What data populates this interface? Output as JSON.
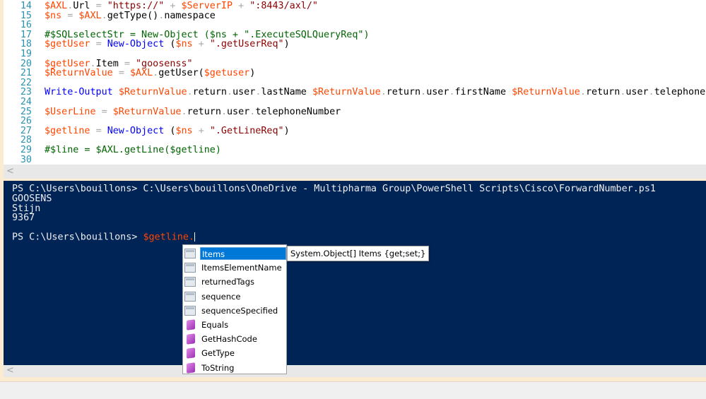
{
  "editor": {
    "lines": [
      {
        "n": "14",
        "t": [
          [
            "var",
            "$AXL"
          ],
          [
            "op",
            "."
          ],
          [
            "mem",
            "Url "
          ],
          [
            "op",
            "= "
          ],
          [
            "str",
            "\"https://\" "
          ],
          [
            "op",
            "+ "
          ],
          [
            "var",
            "$ServerIP "
          ],
          [
            "op",
            "+ "
          ],
          [
            "str",
            "\":8443/axl/\""
          ]
        ]
      },
      {
        "n": "15",
        "t": [
          [
            "var",
            "$ns "
          ],
          [
            "op",
            "= "
          ],
          [
            "var",
            "$AXL"
          ],
          [
            "op",
            "."
          ],
          [
            "mem",
            "getType()"
          ],
          [
            "op",
            "."
          ],
          [
            "mem",
            "namespace"
          ]
        ]
      },
      {
        "n": "16",
        "t": []
      },
      {
        "n": "17",
        "t": [
          [
            "cmt",
            "#$SQLselectStr = New-Object ($ns + \".ExecuteSQLQueryReq\")"
          ]
        ]
      },
      {
        "n": "18",
        "t": [
          [
            "var",
            "$getUser "
          ],
          [
            "op",
            "= "
          ],
          [
            "cmd",
            "New-Object "
          ],
          [
            "mem",
            "("
          ],
          [
            "var",
            "$ns "
          ],
          [
            "op",
            "+ "
          ],
          [
            "str",
            "\".getUserReq\""
          ],
          [
            "mem",
            ")"
          ]
        ]
      },
      {
        "n": "19",
        "t": []
      },
      {
        "n": "20",
        "t": [
          [
            "var",
            "$getUser"
          ],
          [
            "op",
            "."
          ],
          [
            "mem",
            "Item "
          ],
          [
            "op",
            "= "
          ],
          [
            "str",
            "\"goosenss\""
          ]
        ]
      },
      {
        "n": "21",
        "t": [
          [
            "var",
            "$ReturnValue "
          ],
          [
            "op",
            "= "
          ],
          [
            "var",
            "$AXL"
          ],
          [
            "op",
            "."
          ],
          [
            "mem",
            "getUser("
          ],
          [
            "var",
            "$getuser"
          ],
          [
            "mem",
            ")"
          ]
        ]
      },
      {
        "n": "22",
        "t": []
      },
      {
        "n": "23",
        "t": [
          [
            "cmd",
            "Write-Output "
          ],
          [
            "var",
            "$ReturnValue"
          ],
          [
            "op",
            "."
          ],
          [
            "mem",
            "return"
          ],
          [
            "op",
            "."
          ],
          [
            "mem",
            "user"
          ],
          [
            "op",
            "."
          ],
          [
            "mem",
            "lastName "
          ],
          [
            "var",
            "$ReturnValue"
          ],
          [
            "op",
            "."
          ],
          [
            "mem",
            "return"
          ],
          [
            "op",
            "."
          ],
          [
            "mem",
            "user"
          ],
          [
            "op",
            "."
          ],
          [
            "mem",
            "firstName "
          ],
          [
            "var",
            "$ReturnValue"
          ],
          [
            "op",
            "."
          ],
          [
            "mem",
            "return"
          ],
          [
            "op",
            "."
          ],
          [
            "mem",
            "user"
          ],
          [
            "op",
            "."
          ],
          [
            "mem",
            "telephoneNumber"
          ]
        ]
      },
      {
        "n": "24",
        "t": []
      },
      {
        "n": "25",
        "t": [
          [
            "var",
            "$UserLine "
          ],
          [
            "op",
            "= "
          ],
          [
            "var",
            "$ReturnValue"
          ],
          [
            "op",
            "."
          ],
          [
            "mem",
            "return"
          ],
          [
            "op",
            "."
          ],
          [
            "mem",
            "user"
          ],
          [
            "op",
            "."
          ],
          [
            "mem",
            "telephoneNumber"
          ]
        ]
      },
      {
        "n": "26",
        "t": []
      },
      {
        "n": "27",
        "t": [
          [
            "var",
            "$getline "
          ],
          [
            "op",
            "= "
          ],
          [
            "cmd",
            "New-Object "
          ],
          [
            "mem",
            "("
          ],
          [
            "var",
            "$ns "
          ],
          [
            "op",
            "+ "
          ],
          [
            "str",
            "\".GetLineReq\""
          ],
          [
            "mem",
            ")"
          ]
        ]
      },
      {
        "n": "28",
        "t": []
      },
      {
        "n": "29",
        "t": [
          [
            "cmt",
            "#$line = $AXL.getLine($getline)"
          ]
        ]
      },
      {
        "n": "30",
        "t": []
      }
    ]
  },
  "console": {
    "command_line": "PS C:\\Users\\bouillons> C:\\Users\\bouillons\\OneDrive - Multipharma Group\\PowerShell Scripts\\Cisco\\ForwardNumber.ps1",
    "output": [
      "GOOSENS",
      "Stijn",
      "9367"
    ],
    "prompt": "PS C:\\Users\\bouillons> ",
    "input": "$getline."
  },
  "intellisense": {
    "items": [
      {
        "label": "Items",
        "icon": "property-icon",
        "selected": true
      },
      {
        "label": "ItemsElementName",
        "icon": "property-icon"
      },
      {
        "label": "returnedTags",
        "icon": "property-icon"
      },
      {
        "label": "sequence",
        "icon": "property-icon"
      },
      {
        "label": "sequenceSpecified",
        "icon": "property-icon"
      },
      {
        "label": "Equals",
        "icon": "method-icon"
      },
      {
        "label": "GetHashCode",
        "icon": "method-icon"
      },
      {
        "label": "GetType",
        "icon": "method-icon"
      },
      {
        "label": "ToString",
        "icon": "method-icon"
      }
    ],
    "tooltip": "System.Object[] Items {get;set;}"
  },
  "scroll_left_glyph": "<",
  "colors": {
    "console_bg": "#012456",
    "variable": "#ff4500",
    "selection": "#0078d7"
  }
}
